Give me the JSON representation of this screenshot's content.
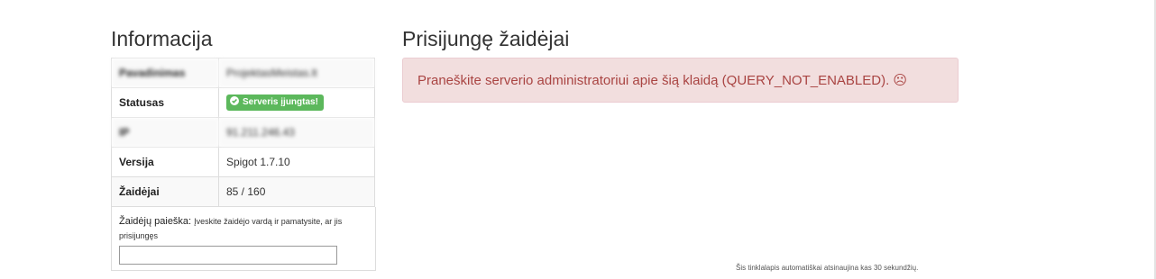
{
  "info": {
    "title": "Informacija",
    "rows": [
      {
        "key": "Pavadinimas",
        "value": "ProjektasMeistas.lt"
      },
      {
        "key": "Statusas",
        "value": "Serveris įjungtas!"
      },
      {
        "key": "IP",
        "value": "91.211.246.43"
      },
      {
        "key": "Versija",
        "value": "Spigot 1.7.10"
      },
      {
        "key": "Žaidėjai",
        "value": "85 / 160"
      }
    ],
    "search": {
      "label": "Žaidėjų paieška:",
      "help": "Įveskite žaidėjo vardą ir pamatysite, ar jis prisijungęs",
      "value": ""
    }
  },
  "players": {
    "title": "Prisijungę žaidėjai",
    "error": "Praneškite serverio administratoriui apie šią klaidą (QUERY_NOT_ENABLED). ☹"
  },
  "footer": {
    "note": "Šis tinklalapis automatiškai atsinaujina kas 30 sekundžių."
  },
  "colors": {
    "status_badge": "#5cb85c",
    "alert_background": "#f2dede",
    "alert_text": "#a94442"
  },
  "icons": {
    "status": "check-circle-icon"
  }
}
